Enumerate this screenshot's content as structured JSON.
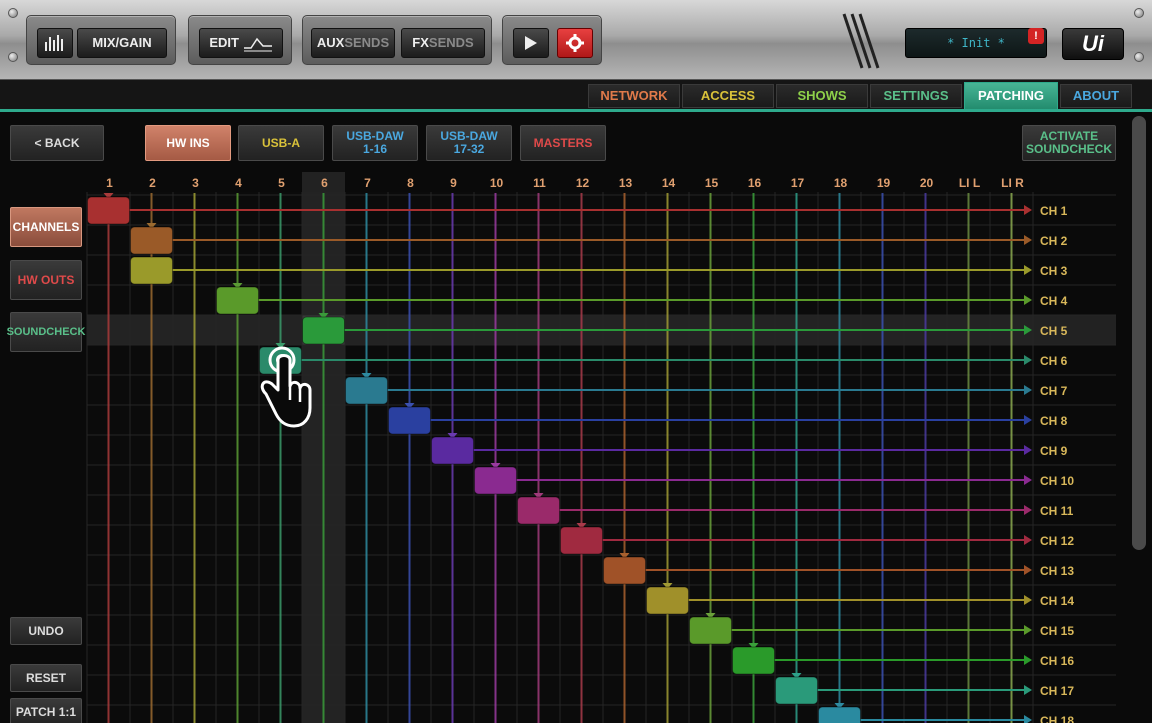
{
  "toolbar": {
    "mix_gain": "MIX/GAIN",
    "edit": "EDIT",
    "aux_a": "AUX",
    "aux_b": "SENDS",
    "fx_a": "FX",
    "fx_b": "SENDS",
    "status": "* Init *",
    "alert": "!",
    "logo": "Ui"
  },
  "nav": {
    "tabs": [
      {
        "label": "NETWORK",
        "color": "#e07a4a"
      },
      {
        "label": "ACCESS",
        "color": "#d9c23a"
      },
      {
        "label": "SHOWS",
        "color": "#8ed04a"
      },
      {
        "label": "SETTINGS",
        "color": "#5ac08a"
      },
      {
        "label": "PATCHING",
        "color": "#ffffff"
      },
      {
        "label": "ABOUT",
        "color": "#4aa8e0"
      }
    ],
    "active": "PATCHING"
  },
  "buttons": {
    "back": "< BACK",
    "hw_ins": "HW INS",
    "usb_a": "USB-A",
    "usb_daw_1_a": "USB-DAW",
    "usb_daw_1_b": "1-16",
    "usb_daw_2_a": "USB-DAW",
    "usb_daw_2_b": "17-32",
    "masters": "MASTERS",
    "activate_a": "ACTIVATE",
    "activate_b": "SOUNDCHECK",
    "channels": "CHANNELS",
    "hw_outs": "HW OUTS",
    "soundcheck": "SOUNDCHECK",
    "undo": "UNDO",
    "reset": "RESET",
    "patch11": "PATCH 1:1"
  },
  "columns": [
    "1",
    "2",
    "3",
    "4",
    "5",
    "6",
    "7",
    "8",
    "9",
    "10",
    "11",
    "12",
    "13",
    "14",
    "15",
    "16",
    "17",
    "18",
    "19",
    "20",
    "LI L",
    "LI R"
  ],
  "column_colors": [
    "#a83a3a",
    "#9a6a30",
    "#a0a034",
    "#5a9a34",
    "#3a9a6a",
    "#3a9a3a",
    "#2e8aa0",
    "#3a50b0",
    "#6a3ab0",
    "#9a3aa0",
    "#a03a7a",
    "#a83a4a",
    "#a8602e",
    "#a09a34",
    "#6aa03a",
    "#3aa03a",
    "#2ea08a",
    "#2e8aa0",
    "#3a50b0",
    "#4a3aa0",
    "#6a8a40",
    "#8aaa50"
  ],
  "rows": [
    "CH 1",
    "CH 2",
    "CH 3",
    "CH 4",
    "CH 5",
    "CH 6",
    "CH 7",
    "CH 8",
    "CH 9",
    "CH 10",
    "CH 11",
    "CH 12",
    "CH 13",
    "CH 14",
    "CH 15",
    "CH 16",
    "CH 17",
    "CH 18"
  ],
  "patches": [
    {
      "row": 0,
      "col": 0,
      "color": "#a83030"
    },
    {
      "row": 1,
      "col": 1,
      "color": "#9a5a28"
    },
    {
      "row": 2,
      "col": 1,
      "color": "#9a9a2a"
    },
    {
      "row": 3,
      "col": 3,
      "color": "#5a9a2a"
    },
    {
      "row": 4,
      "col": 5,
      "color": "#2a9a3a"
    },
    {
      "row": 5,
      "col": 4,
      "color": "#2a8a6a"
    },
    {
      "row": 6,
      "col": 6,
      "color": "#2a7a90"
    },
    {
      "row": 7,
      "col": 7,
      "color": "#2a40a0"
    },
    {
      "row": 8,
      "col": 8,
      "color": "#5a2aa0"
    },
    {
      "row": 9,
      "col": 9,
      "color": "#8a2a90"
    },
    {
      "row": 10,
      "col": 10,
      "color": "#9a2a6a"
    },
    {
      "row": 11,
      "col": 11,
      "color": "#a02a40"
    },
    {
      "row": 12,
      "col": 12,
      "color": "#a05228"
    },
    {
      "row": 13,
      "col": 13,
      "color": "#a0902a"
    },
    {
      "row": 14,
      "col": 14,
      "color": "#5a9a2a"
    },
    {
      "row": 15,
      "col": 15,
      "color": "#2a9a2a"
    },
    {
      "row": 16,
      "col": 16,
      "color": "#2a9a7a"
    },
    {
      "row": 17,
      "col": 17,
      "color": "#2a8aa0"
    }
  ],
  "highlight": {
    "row": 4,
    "col": 5
  },
  "touch_icon": "hand-pointer-icon"
}
